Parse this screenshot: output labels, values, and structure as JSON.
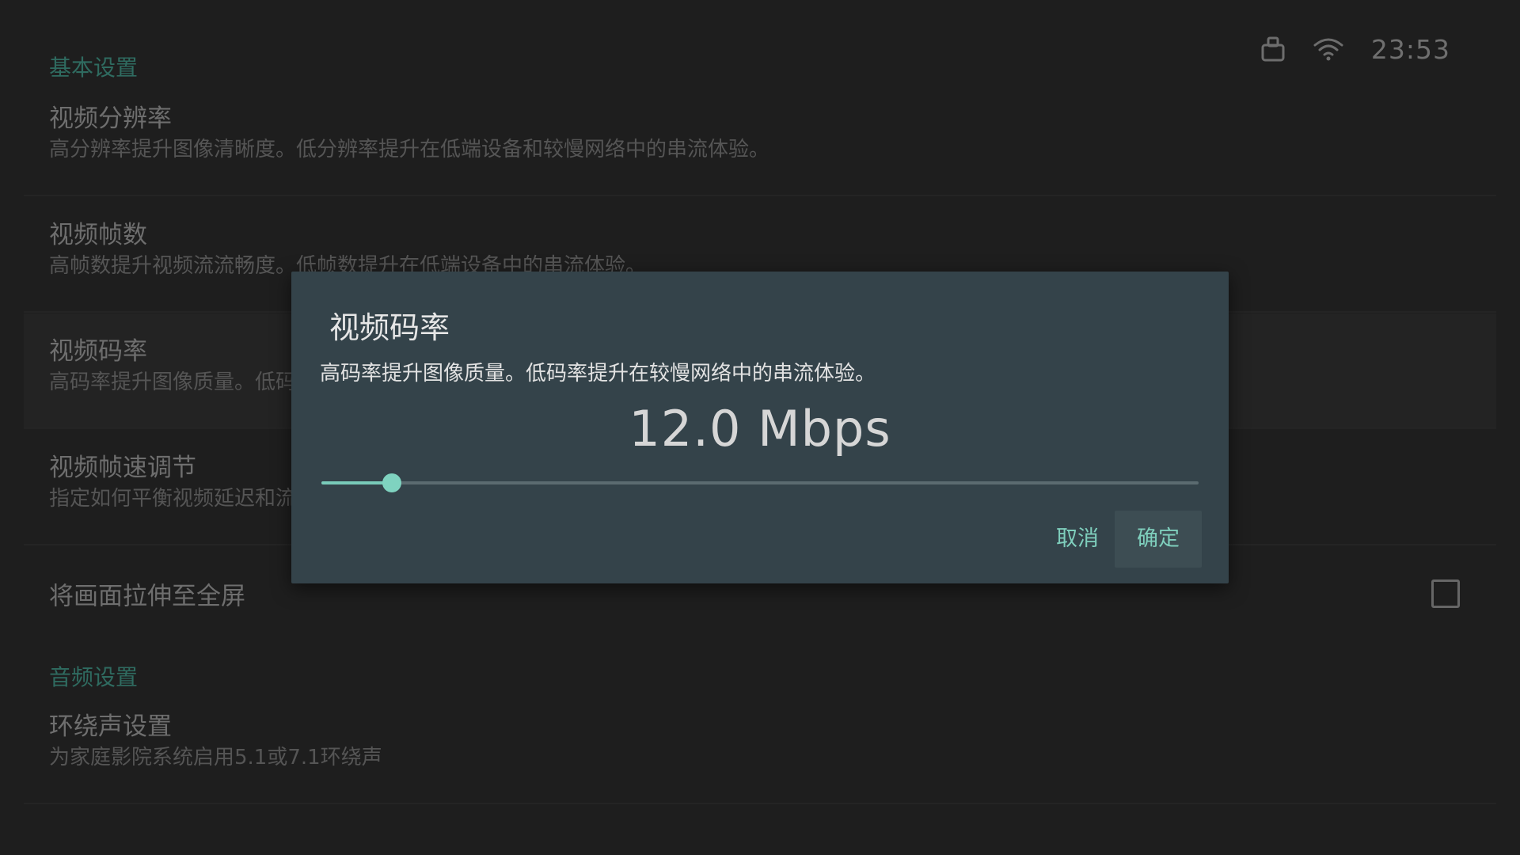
{
  "status_bar": {
    "icons": [
      "lock-icon",
      "wifi-icon"
    ],
    "time": "23:53"
  },
  "sections": [
    {
      "header": "基本设置",
      "items": [
        {
          "title": "视频分辨率",
          "summary": "高分辨率提升图像清晰度。低分辨率提升在低端设备和较慢网络中的串流体验。"
        },
        {
          "title": "视频帧数",
          "summary": "高帧数提升视频流流畅度。低帧数提升在低端设备中的串流体验。"
        },
        {
          "title": "视频码率",
          "summary": "高码率提升图像质量。低码率提升在较慢网络中的串流体验。",
          "selected": true
        },
        {
          "title": "视频帧速调节",
          "summary": "指定如何平衡视频延迟和流畅度"
        },
        {
          "title": "将画面拉伸至全屏",
          "checked": false
        }
      ]
    },
    {
      "header": "音频设置",
      "items": [
        {
          "title": "环绕声设置",
          "summary": "为家庭影院系统启用5.1或7.1环绕声"
        }
      ]
    }
  ],
  "dialog": {
    "title": "视频码率",
    "message": "高码率提升图像质量。低码率提升在较慢网络中的串流体验。",
    "value_text": "12.0 Mbps",
    "slider_fraction": 0.08,
    "cancel_label": "取消",
    "ok_label": "确定"
  },
  "colors": {
    "accent": "#7fcfbd",
    "dialog_bg": "#34434a",
    "background": "#1e1e1e"
  }
}
